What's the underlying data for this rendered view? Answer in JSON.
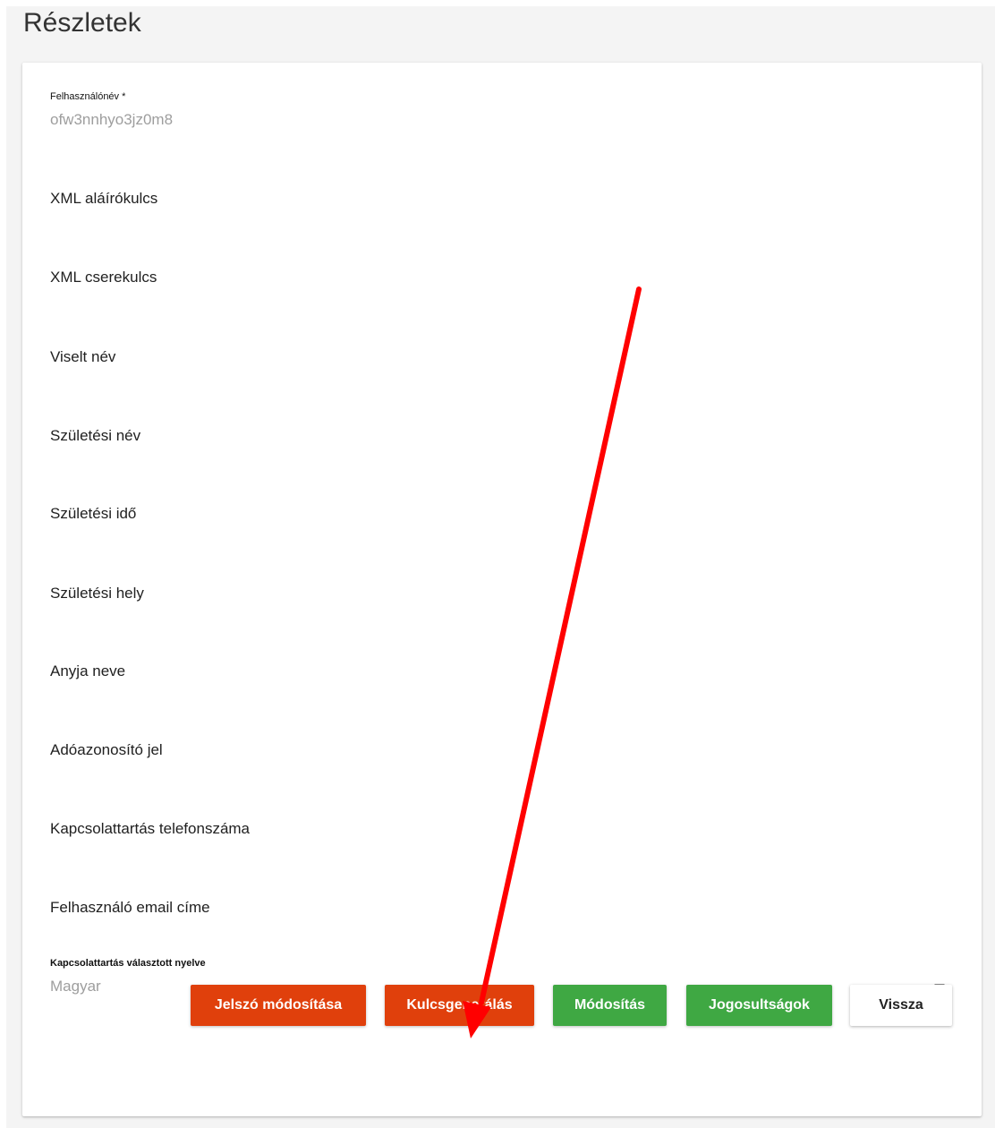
{
  "page": {
    "title": "Részletek"
  },
  "form": {
    "username": {
      "label": "Felhasználónév *",
      "value": "ofw3nnhyo3jz0m8"
    },
    "fields": [
      "XML aláírókulcs",
      "XML cserekulcs",
      "Viselt név",
      "Születési név",
      "Születési idő",
      "Születési hely",
      "Anyja neve",
      "Adóazonosító jel",
      "Kapcsolattartás telefonszáma",
      "Felhasználó email címe"
    ],
    "language": {
      "label": "Kapcsolattartás választott nyelve",
      "value": "Magyar",
      "icon": "chevron-down-icon"
    }
  },
  "actions": {
    "change_password": "Jelszó módosítása",
    "key_generation": "Kulcsgenerálás",
    "modify": "Módosítás",
    "permissions": "Jogosultságok",
    "back": "Vissza"
  },
  "colors": {
    "accent_orange": "#e0400c",
    "accent_green": "#3fa843",
    "annotation_arrow": "#ff0000"
  }
}
